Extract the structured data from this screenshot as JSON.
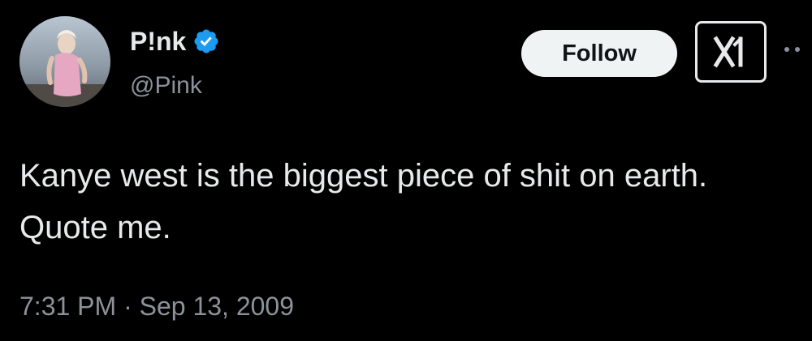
{
  "author": {
    "display_name": "P!nk",
    "handle": "@Pink",
    "verified": true
  },
  "actions": {
    "follow_label": "Follow"
  },
  "tweet": {
    "text": "Kanye west is the biggest piece of shit on earth. Quote me.",
    "timestamp": "7:31 PM · Sep 13, 2009"
  },
  "icons": {
    "verified": "verified-badge-icon",
    "grok": "grok-icon",
    "more": "more-options-icon"
  },
  "colors": {
    "background": "#000000",
    "primary_text": "#e7e9ea",
    "secondary_text": "#8b9299",
    "verified_blue": "#1d9bf0",
    "follow_bg": "#eff3f4",
    "follow_text": "#0f1419"
  }
}
